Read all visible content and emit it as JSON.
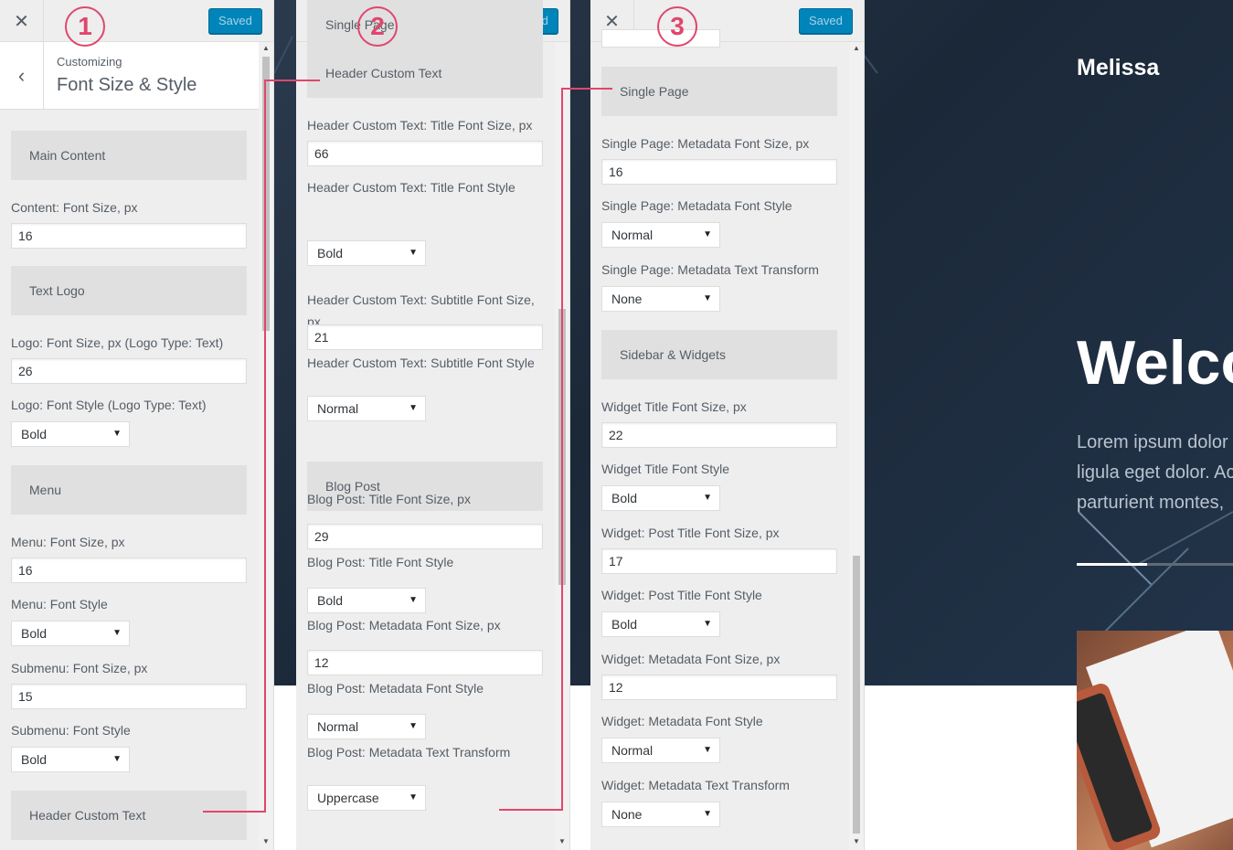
{
  "window": {
    "close_symbol": "✕",
    "saved_label": "Saved"
  },
  "badges": [
    "1",
    "2",
    "3"
  ],
  "panel1": {
    "header": {
      "small": "Customizing",
      "title": "Font Size & Style"
    },
    "items": [
      {
        "type": "section",
        "label": "Main Content"
      },
      {
        "type": "label",
        "label": "Content: Font Size, px"
      },
      {
        "type": "input",
        "value": "16"
      },
      {
        "type": "section",
        "label": "Text Logo"
      },
      {
        "type": "label",
        "label": "Logo: Font Size, px (Logo Type: Text)"
      },
      {
        "type": "input",
        "value": "26"
      },
      {
        "type": "label",
        "label": "Logo: Font Style (Logo Type: Text)"
      },
      {
        "type": "select",
        "value": "Bold"
      },
      {
        "type": "section",
        "label": "Menu"
      },
      {
        "type": "label",
        "label": "Menu: Font Size, px"
      },
      {
        "type": "input",
        "value": "16"
      },
      {
        "type": "label",
        "label": "Menu: Font Style"
      },
      {
        "type": "select",
        "value": "Bold"
      },
      {
        "type": "label",
        "label": "Submenu: Font Size, px"
      },
      {
        "type": "input",
        "value": "15"
      },
      {
        "type": "label",
        "label": "Submenu: Font Style"
      },
      {
        "type": "select",
        "value": "Bold"
      },
      {
        "type": "section",
        "label": "Header Custom Text"
      }
    ]
  },
  "panel2": {
    "items": [
      {
        "type": "section",
        "label": "Header Custom Text"
      },
      {
        "type": "label",
        "label": "Header Custom Text: Title Font Size, px"
      },
      {
        "type": "input",
        "value": "66"
      },
      {
        "type": "label",
        "label": "Header Custom Text: Title Font Style"
      },
      {
        "type": "select",
        "value": "Bold"
      },
      {
        "type": "label",
        "label": "Header Custom Text: Subtitle Font Size, px"
      },
      {
        "type": "input",
        "value": "21"
      },
      {
        "type": "label",
        "label": "Header Custom Text: Subtitle Font Style"
      },
      {
        "type": "select",
        "value": "Normal"
      },
      {
        "type": "section",
        "label": "Blog Post"
      },
      {
        "type": "label",
        "label": "Blog Post: Title Font Size, px"
      },
      {
        "type": "input",
        "value": "29"
      },
      {
        "type": "label",
        "label": "Blog Post: Title Font Style"
      },
      {
        "type": "select",
        "value": "Bold"
      },
      {
        "type": "label",
        "label": "Blog Post: Metadata Font Size, px"
      },
      {
        "type": "input",
        "value": "12"
      },
      {
        "type": "label",
        "label": "Blog Post: Metadata Font Style"
      },
      {
        "type": "select",
        "value": "Normal"
      },
      {
        "type": "label",
        "label": "Blog Post: Metadata Text Transform"
      },
      {
        "type": "select",
        "value": "Uppercase"
      },
      {
        "type": "section",
        "label": "Single Page"
      }
    ]
  },
  "panel3": {
    "items": [
      {
        "type": "section",
        "label": "Single Page"
      },
      {
        "type": "label",
        "label": "Single Page: Metadata Font Size, px"
      },
      {
        "type": "input",
        "value": "16"
      },
      {
        "type": "label",
        "label": "Single Page: Metadata Font Style"
      },
      {
        "type": "select",
        "value": "Normal"
      },
      {
        "type": "label",
        "label": "Single Page: Metadata Text Transform"
      },
      {
        "type": "select",
        "value": "None"
      },
      {
        "type": "section",
        "label": "Sidebar & Widgets"
      },
      {
        "type": "label",
        "label": "Widget Title Font Size, px"
      },
      {
        "type": "input",
        "value": "22"
      },
      {
        "type": "label",
        "label": "Widget Title Font Style"
      },
      {
        "type": "select",
        "value": "Bold"
      },
      {
        "type": "label",
        "label": "Widget: Post Title Font Size, px"
      },
      {
        "type": "input",
        "value": "17"
      },
      {
        "type": "label",
        "label": "Widget: Post Title Font Style"
      },
      {
        "type": "select",
        "value": "Bold"
      },
      {
        "type": "label",
        "label": "Widget: Metadata Font Size, px"
      },
      {
        "type": "input",
        "value": "12"
      },
      {
        "type": "label",
        "label": "Widget: Metadata Font Style"
      },
      {
        "type": "select",
        "value": "Normal"
      },
      {
        "type": "label",
        "label": "Widget: Metadata Text Transform"
      },
      {
        "type": "select",
        "value": "None"
      }
    ]
  },
  "preview": {
    "site_title": "Melissa",
    "hero_title": "Welco",
    "hero_lines": [
      "Lorem ipsum dolor",
      "ligula eget dolor. Ac",
      "parturient montes,"
    ],
    "slider_progress": 0.45
  },
  "colors": {
    "accent": "#0085ba",
    "annotation": "#e0466d"
  }
}
